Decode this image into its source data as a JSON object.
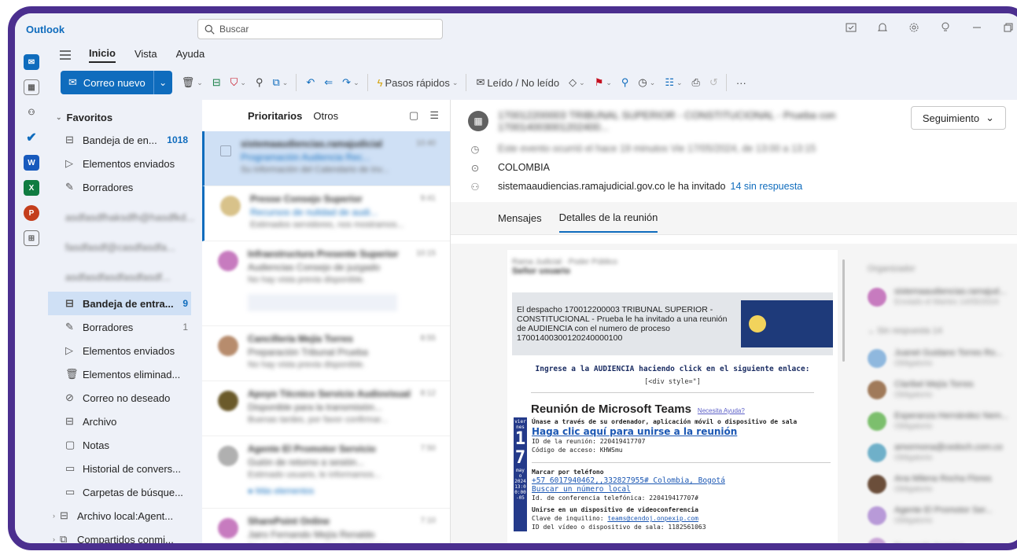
{
  "app": {
    "title": "Outlook"
  },
  "search": {
    "placeholder": "Buscar"
  },
  "ribbon": {
    "tabs": [
      "Inicio",
      "Vista",
      "Ayuda"
    ]
  },
  "toolbar": {
    "new_mail": "Correo nuevo",
    "quick_steps": "Pasos rápidos",
    "read_unread": "Leído / No leído"
  },
  "folders": {
    "favorites_label": "Favoritos",
    "favorites": [
      {
        "label": "Bandeja de en...",
        "count": "1018"
      },
      {
        "label": "Elementos enviados",
        "count": ""
      },
      {
        "label": "Borradores",
        "count": ""
      }
    ],
    "accounts_blurred": [
      "asdfasdfhaksdfh@hasdfkd...",
      "fasdfasdf@casdfasdfa...",
      "asdfasdfasdfasdfasdf..."
    ],
    "mailbox": [
      {
        "label": "Bandeja de entra...",
        "count": "9"
      },
      {
        "label": "Borradores",
        "count": "1"
      },
      {
        "label": "Elementos enviados",
        "count": ""
      },
      {
        "label": "Elementos eliminad...",
        "count": ""
      },
      {
        "label": "Correo no deseado",
        "count": ""
      },
      {
        "label": "Archivo",
        "count": ""
      },
      {
        "label": "Notas",
        "count": ""
      },
      {
        "label": "Historial de convers...",
        "count": ""
      },
      {
        "label": "Carpetas de búsque...",
        "count": ""
      },
      {
        "label": "Archivo local:Agent...",
        "count": ""
      },
      {
        "label": "Compartidos conmi...",
        "count": ""
      }
    ]
  },
  "message_list": {
    "tabs": [
      "Prioritarios",
      "Otros"
    ]
  },
  "reading": {
    "follow_up": "Seguimiento",
    "location": "COLOMBIA",
    "invite_text": "sistemaaudiencias.ramajudicial.gov.co le ha invitado",
    "no_response": "14 sin respuesta",
    "tabs": [
      "Mensajes",
      "Detalles de la reunión"
    ],
    "banner_text": "El despacho 170012200003 TRIBUNAL SUPERIOR - CONSTITUCIONAL - Prueba le ha invitado a una reunión de AUDIENCIA con el numero de proceso 17001400300120240000100",
    "ingrese": "Ingrese a la AUDIENCIA haciendo click en el siguiente enlace:",
    "div_style": "[<div style=\"]",
    "teams_title": "Reunión de Microsoft Teams",
    "help_link": "Necesita Ayuda?",
    "join_via": "Únase a través de su ordenador, aplicación móvil o dispositivo de sala",
    "join_link": "Haga clic aquí para unirse a la reunión",
    "meeting_id": "ID de la reunión: 220419417707",
    "access_code": "Código de acceso: KHWSmu",
    "dial_label": "Marcar por teléfono",
    "phone": "+57 6017940462,,332827955# Colombia, Bogotá",
    "find_number": "Buscar un número local",
    "conf_id": "Id. de conferencia telefónica: 220419417707#",
    "video_label": "Unirse en un dispositivo de videoconferencia",
    "tenant_key_label": "Clave de inquilino:",
    "tenant_key": "teams@cendoj.onpexip.com",
    "video_id": "ID del vídeo o dispositivo de sala: 1182561063",
    "date_col": {
      "weekday": "vier nes",
      "day1": "1",
      "day2": "7",
      "month": "may o 2024",
      "time": "13:0 0:00 -05"
    }
  },
  "colors": {
    "brand": "#0f6cbd",
    "frame": "#4b2f8f",
    "selected": "#cfe0f5"
  }
}
